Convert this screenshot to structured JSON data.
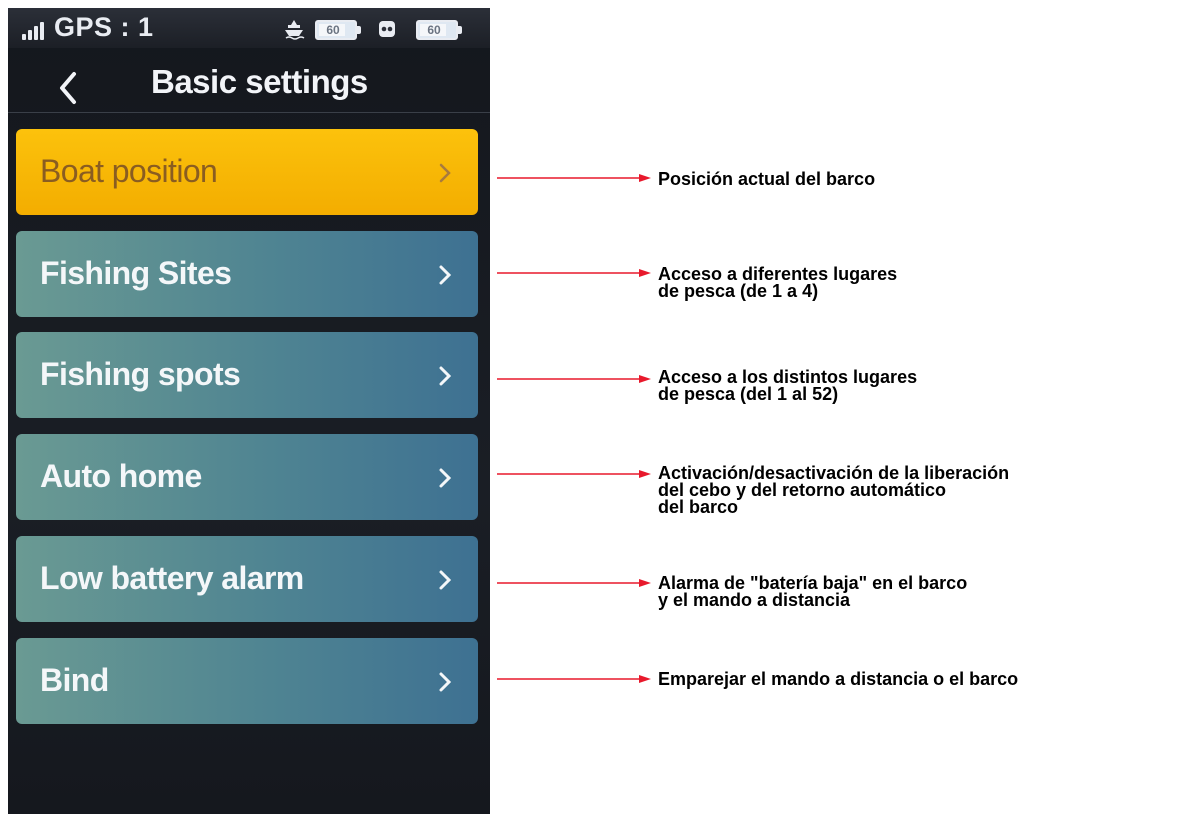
{
  "status_bar": {
    "gps_label": "GPS : 1",
    "boat_battery": "60",
    "remote_battery": "60",
    "icons": [
      "signal-icon",
      "boat-icon",
      "battery-icon",
      "remote-icon",
      "battery-icon"
    ]
  },
  "header": {
    "back_icon": "chevron-left-icon",
    "title": "Basic settings"
  },
  "menu": {
    "items": [
      {
        "label": "Boat position",
        "selected": true
      },
      {
        "label": "Fishing Sites",
        "selected": false
      },
      {
        "label": "Fishing spots",
        "selected": false
      },
      {
        "label": "Auto home",
        "selected": false
      },
      {
        "label": "Low battery alarm",
        "selected": false
      },
      {
        "label": "Bind",
        "selected": false
      }
    ]
  },
  "annotations": [
    "Posición actual del barco",
    "Acceso a diferentes lugares\nde pesca (de 1 a 4)",
    "Acceso a los distintos lugares\nde pesca (del 1 al 52)",
    "Activación/desactivación de la liberación\ndel cebo y del retorno automático\ndel barco",
    "Alarma de \"batería baja\" en el barco\ny el mando a distancia",
    "Emparejar el mando a distancia o el barco"
  ],
  "colors": {
    "selected_item": "#f3ad00",
    "item_gradient_start": "#6a9a93",
    "item_gradient_end": "#3e7192",
    "annotation_arrow": "#e8192c"
  }
}
